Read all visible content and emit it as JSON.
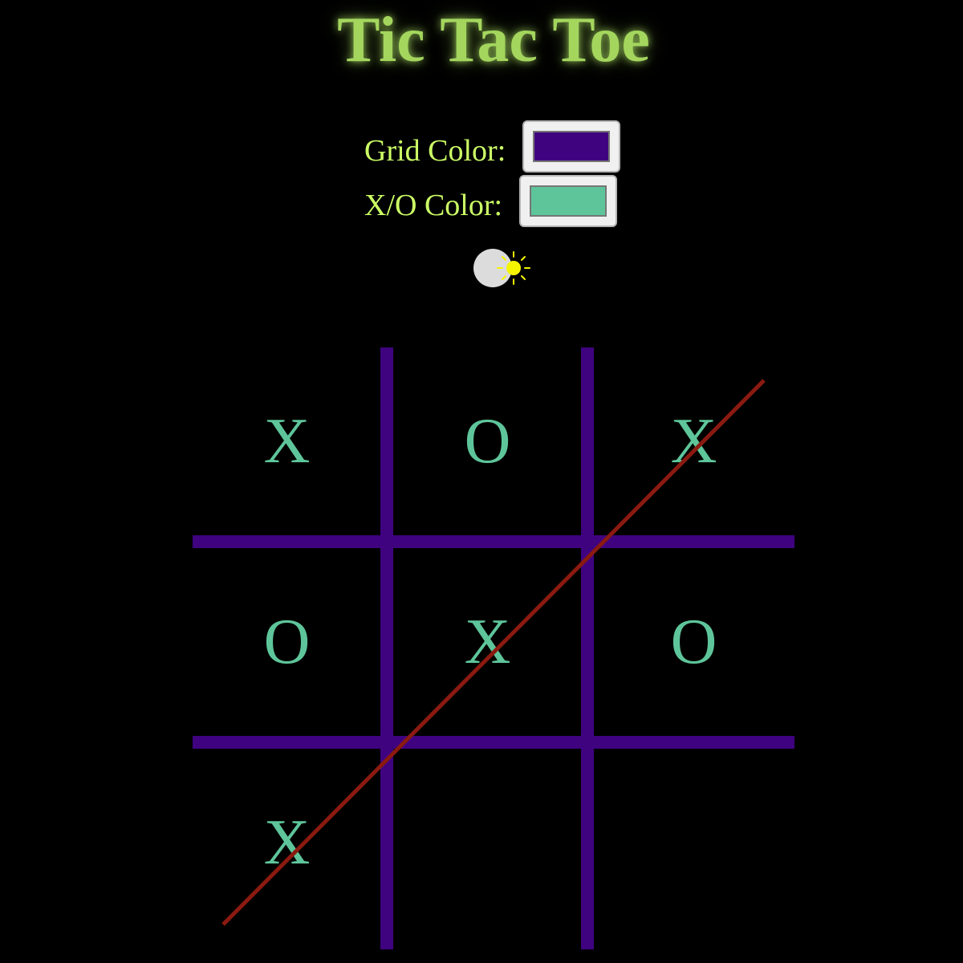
{
  "title": "Tic Tac Toe",
  "controls": {
    "grid_color_label": "Grid Color:",
    "grid_color_value": "#3f0380",
    "mark_color_label": "X/O Color:",
    "mark_color_value": "#5ec59a",
    "theme_toggle_icon": "sun-icon"
  },
  "colors": {
    "background": "#000000",
    "title": "#a4d65e",
    "labels": "#ccff66",
    "win_line": "#8b1a10"
  },
  "board": {
    "cells": [
      "X",
      "O",
      "X",
      "O",
      "X",
      "O",
      "X",
      "",
      ""
    ],
    "winning_line": "diagonal from bottom-left to top-right"
  }
}
